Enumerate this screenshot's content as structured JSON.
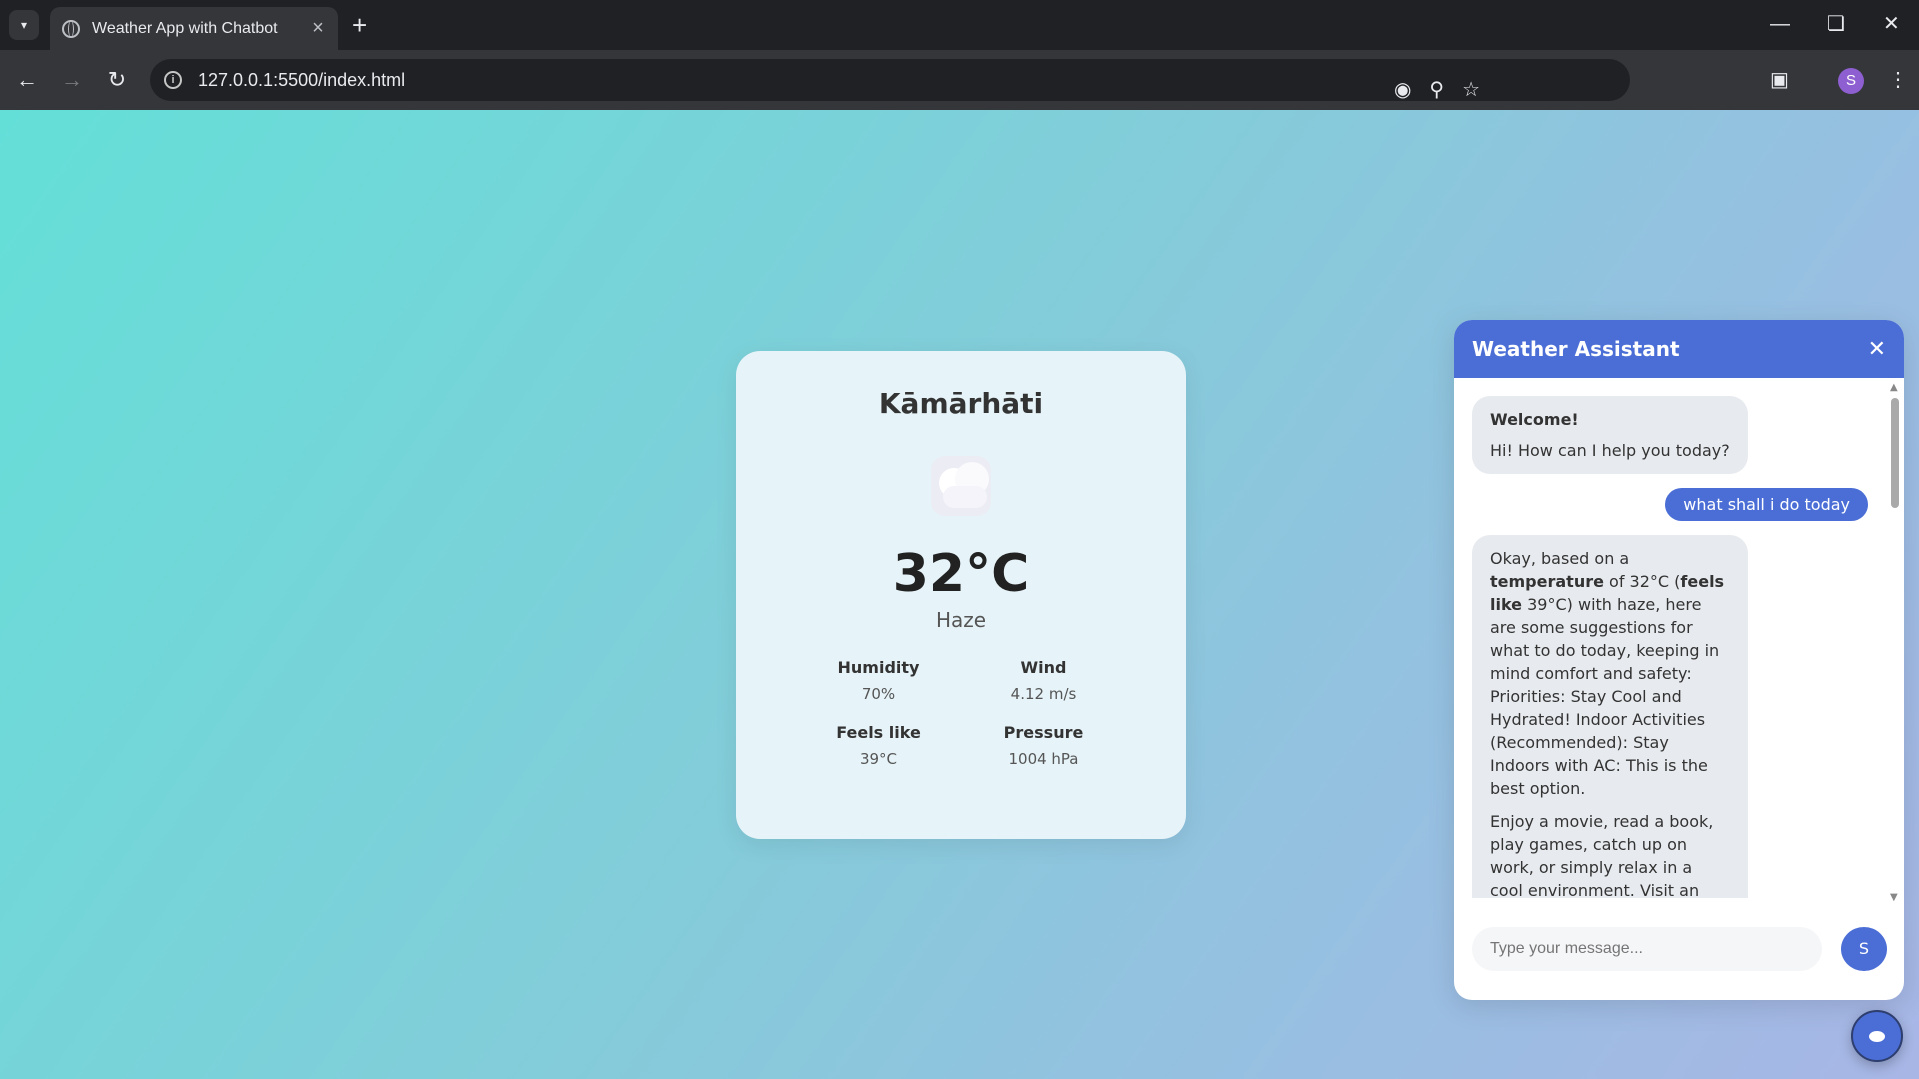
{
  "browser": {
    "tab_title": "Weather App with Chatbot",
    "url": "127.0.0.1:5500/index.html",
    "profile_initial": "S"
  },
  "weather": {
    "city": "Kāmārhāti",
    "temperature": "32°C",
    "condition": "Haze",
    "icon": "haze-cloud-icon",
    "stats": [
      {
        "label": "Humidity",
        "value": "70%"
      },
      {
        "label": "Wind",
        "value": "4.12 m/s"
      },
      {
        "label": "Feels like",
        "value": "39°C"
      },
      {
        "label": "Pressure",
        "value": "1004 hPa"
      }
    ]
  },
  "chat": {
    "title": "Weather Assistant",
    "welcome_title": "Welcome!",
    "welcome_text": "Hi! How can I help you today?",
    "user_message": "what shall i do today",
    "reply": {
      "p1_a": "Okay, based on a ",
      "p1_b": "temperature",
      "p1_c": " of 32°C (",
      "p1_d": "feels like",
      "p1_e": " 39°C) with haze, here are some suggestions for what to do today, keeping in mind comfort and safety: Priorities: Stay Cool and Hydrated! Indoor Activities (Recommended): Stay Indoors with AC: This is the best option.",
      "p2": "Enjoy a movie, read a book, play games, catch up on work, or simply relax in a cool environment. Visit an Air-Conditioned Public Space: Libraries, shopping malls"
    },
    "input_placeholder": "Type your message...",
    "send_label": "S"
  },
  "colors": {
    "accent": "#4a6ed6",
    "card_bg": "#e6f3f8"
  }
}
